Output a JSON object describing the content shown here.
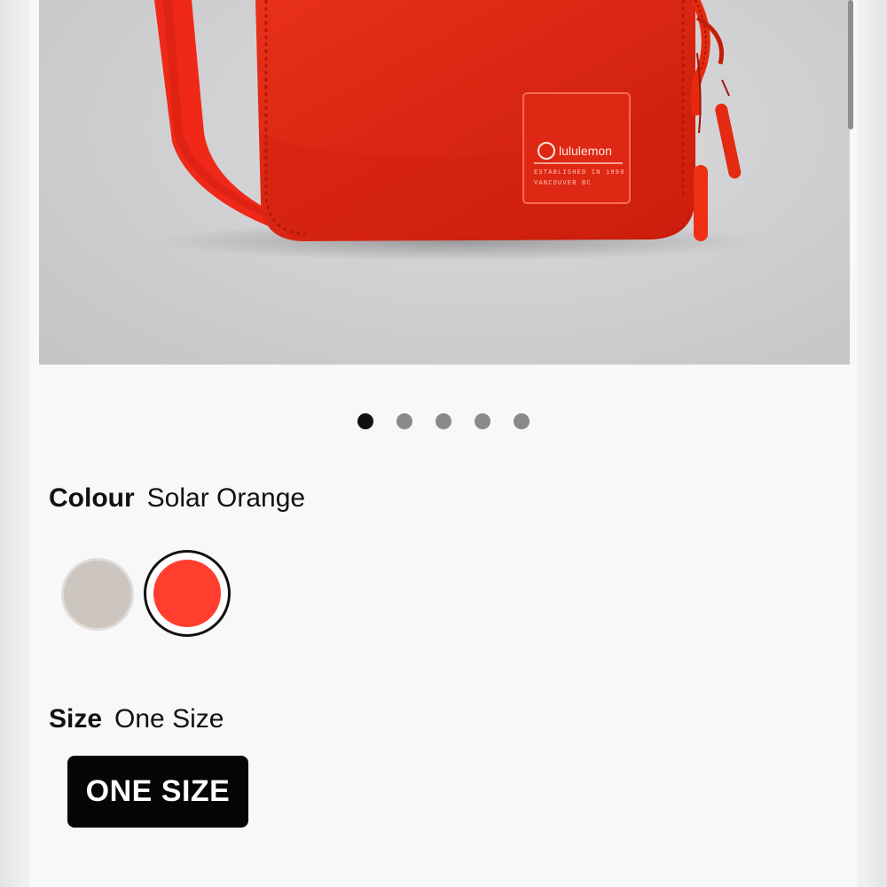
{
  "product_image": {
    "brand_label": "lululemon",
    "tag_line1": "ESTABLISHED IN 1998",
    "tag_line2": "VANCOUVER BC",
    "colors": {
      "bag": "#e4230f",
      "strap": "#f02818",
      "background": "#d4d4d6"
    }
  },
  "carousel": {
    "count": 5,
    "active_index": 0
  },
  "colour": {
    "label": "Colour",
    "selected_name": "Solar Orange",
    "swatches": [
      {
        "color": "#cdc6c0",
        "selected": false
      },
      {
        "color": "#ff3e2e",
        "selected": true
      }
    ]
  },
  "size": {
    "label": "Size",
    "selected_value": "One Size",
    "options": [
      {
        "label": "ONE SIZE",
        "selected": true
      }
    ]
  }
}
